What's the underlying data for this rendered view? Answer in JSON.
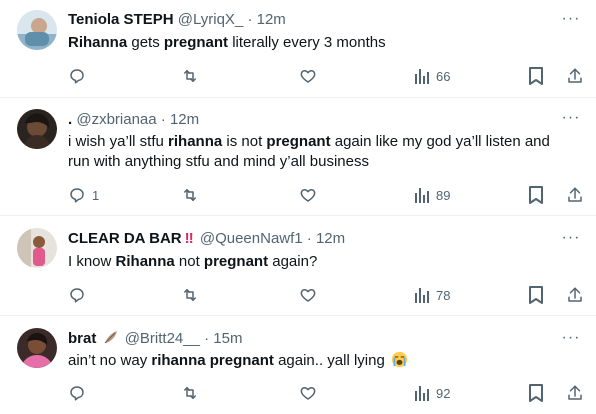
{
  "tweets": [
    {
      "name": "Teniola STEPH",
      "handle": "@LyriqX_",
      "sep": "·",
      "time": "12m",
      "text_parts": [
        {
          "t": "",
          "b": "Rihanna"
        },
        {
          "t": " gets ",
          "b": "pregnant"
        },
        {
          "t": " literally every 3 months",
          "b": ""
        }
      ],
      "replies": "",
      "views": "66"
    },
    {
      "name": ".",
      "handle": "@zxbrianaa",
      "sep": "·",
      "time": "12m",
      "text_parts": [
        {
          "t": "i wish ya’ll stfu ",
          "b": "rihanna"
        },
        {
          "t": " is not ",
          "b": "pregnant"
        },
        {
          "t": " again like my god ya’ll listen and run with anything stfu and mind y’all business",
          "b": ""
        }
      ],
      "replies": "1",
      "views": "89"
    },
    {
      "name": "CLEAR DA BAR",
      "badge": "‼",
      "handle": "@QueenNawf1",
      "sep": "·",
      "time": "12m",
      "text_parts": [
        {
          "t": "I know ",
          "b": "Rihanna"
        },
        {
          "t": " not ",
          "b": "pregnant"
        },
        {
          "t": " again?",
          "b": ""
        }
      ],
      "replies": "",
      "views": "78"
    },
    {
      "name": "brat",
      "handle": "@Britt24__",
      "sep": "·",
      "time": "15m",
      "text_parts": [
        {
          "t": "ain’t no way ",
          "b": "rihanna pregnant"
        },
        {
          "t": " again.. yall lying",
          "b": ""
        }
      ],
      "replies": "",
      "views": "92"
    }
  ],
  "more_label": "···",
  "icons": {
    "reply": "reply-icon",
    "retweet": "retweet-icon",
    "like": "like-icon",
    "views": "views-icon",
    "bookmark": "bookmark-icon",
    "share": "share-icon",
    "more": "more-icon",
    "feather": "feather-emoji-icon",
    "crying": "loudly-crying-face-emoji-icon"
  },
  "colors": {
    "text": "#0f1419",
    "secondary": "#536471",
    "divider": "#eff3f4",
    "badge": "#e0245e"
  }
}
